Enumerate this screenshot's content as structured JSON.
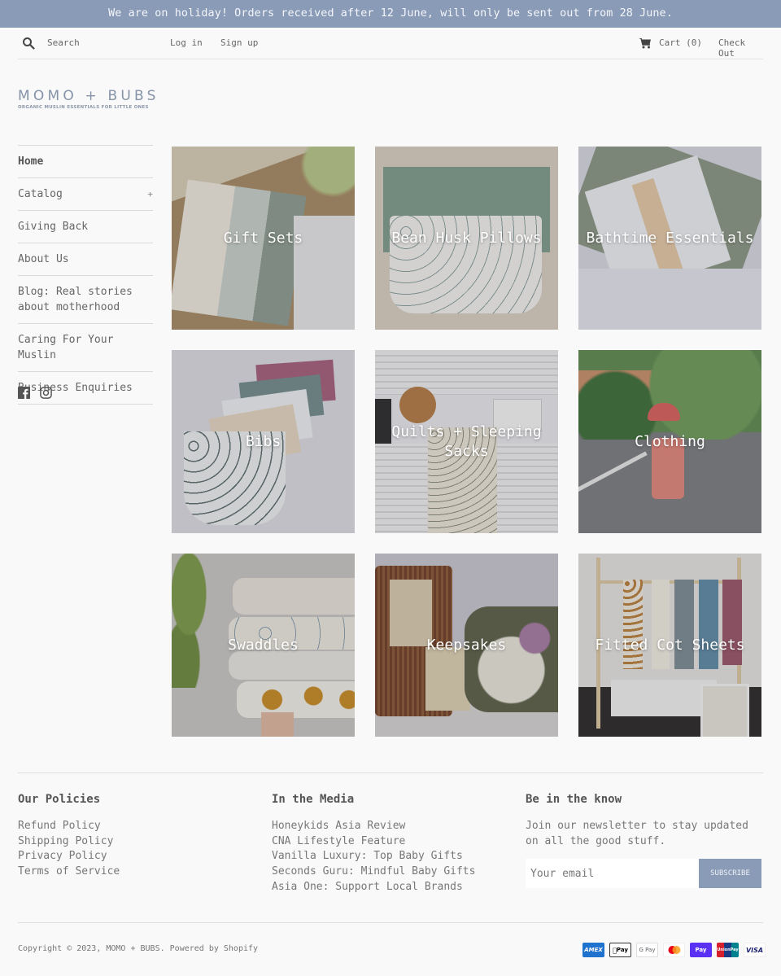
{
  "announcement": "We are on holiday! Orders received after 12 June, will only be sent out from 28 June.",
  "header": {
    "search_placeholder": "Search",
    "login": "Log in",
    "signup": "Sign up",
    "cart": "Cart (0)",
    "checkout": "Check Out"
  },
  "logo": {
    "name": "MOMO + BUBS",
    "tagline": "ORGANIC MUSLIN ESSENTIALS FOR LITTLE ONES"
  },
  "sidebar": {
    "items": [
      {
        "label": "Home"
      },
      {
        "label": "Catalog",
        "expander": "+"
      },
      {
        "label": "Giving Back"
      },
      {
        "label": "About Us"
      },
      {
        "label": "Blog: Real stories about motherhood"
      },
      {
        "label": "Caring For Your Muslin"
      },
      {
        "label": "Business Enquiries"
      }
    ]
  },
  "collections": [
    {
      "label": "Gift Sets"
    },
    {
      "label": "Bean Husk Pillows"
    },
    {
      "label": "Bathtime Essentials"
    },
    {
      "label": "Bibs"
    },
    {
      "label": "Quilts + Sleeping Sacks"
    },
    {
      "label": "Clothing"
    },
    {
      "label": "Swaddles"
    },
    {
      "label": "Keepsakes"
    },
    {
      "label": "Fitted Cot Sheets"
    }
  ],
  "footer": {
    "policies": {
      "title": "Our Policies",
      "links": [
        "Refund Policy",
        "Shipping Policy",
        "Privacy Policy",
        "Terms of Service"
      ]
    },
    "media": {
      "title": "In the Media",
      "links": [
        "Honeykids Asia Review",
        "CNA Lifestyle Feature",
        "Vanilla Luxury: Top Baby Gifts",
        "Seconds Guru: Mindful Baby Gifts",
        "Asia One: Support Local Brands"
      ]
    },
    "newsletter": {
      "title": "Be in the know",
      "text": "Join our newsletter to stay updated on all the good stuff.",
      "placeholder": "Your email",
      "button": "SUBSCRIBE"
    },
    "copyright_prefix": "Copyright © 2023, ",
    "brand_link": "MOMO + BUBS",
    "powered": ". Powered by Shopify",
    "payments": [
      "American Express",
      "Apple Pay",
      "Google Pay",
      "Mastercard",
      "Shop Pay",
      "UnionPay",
      "Visa"
    ],
    "payment_labels": {
      "amex": "AMEX",
      "apple": "Pay",
      "google": "G Pay",
      "shop": "Pay",
      "union": "UnionPay",
      "visa": "VISA"
    }
  },
  "colors": {
    "accent": "#8a9bb7",
    "background": "#f9f9f9",
    "text": "#555555"
  }
}
